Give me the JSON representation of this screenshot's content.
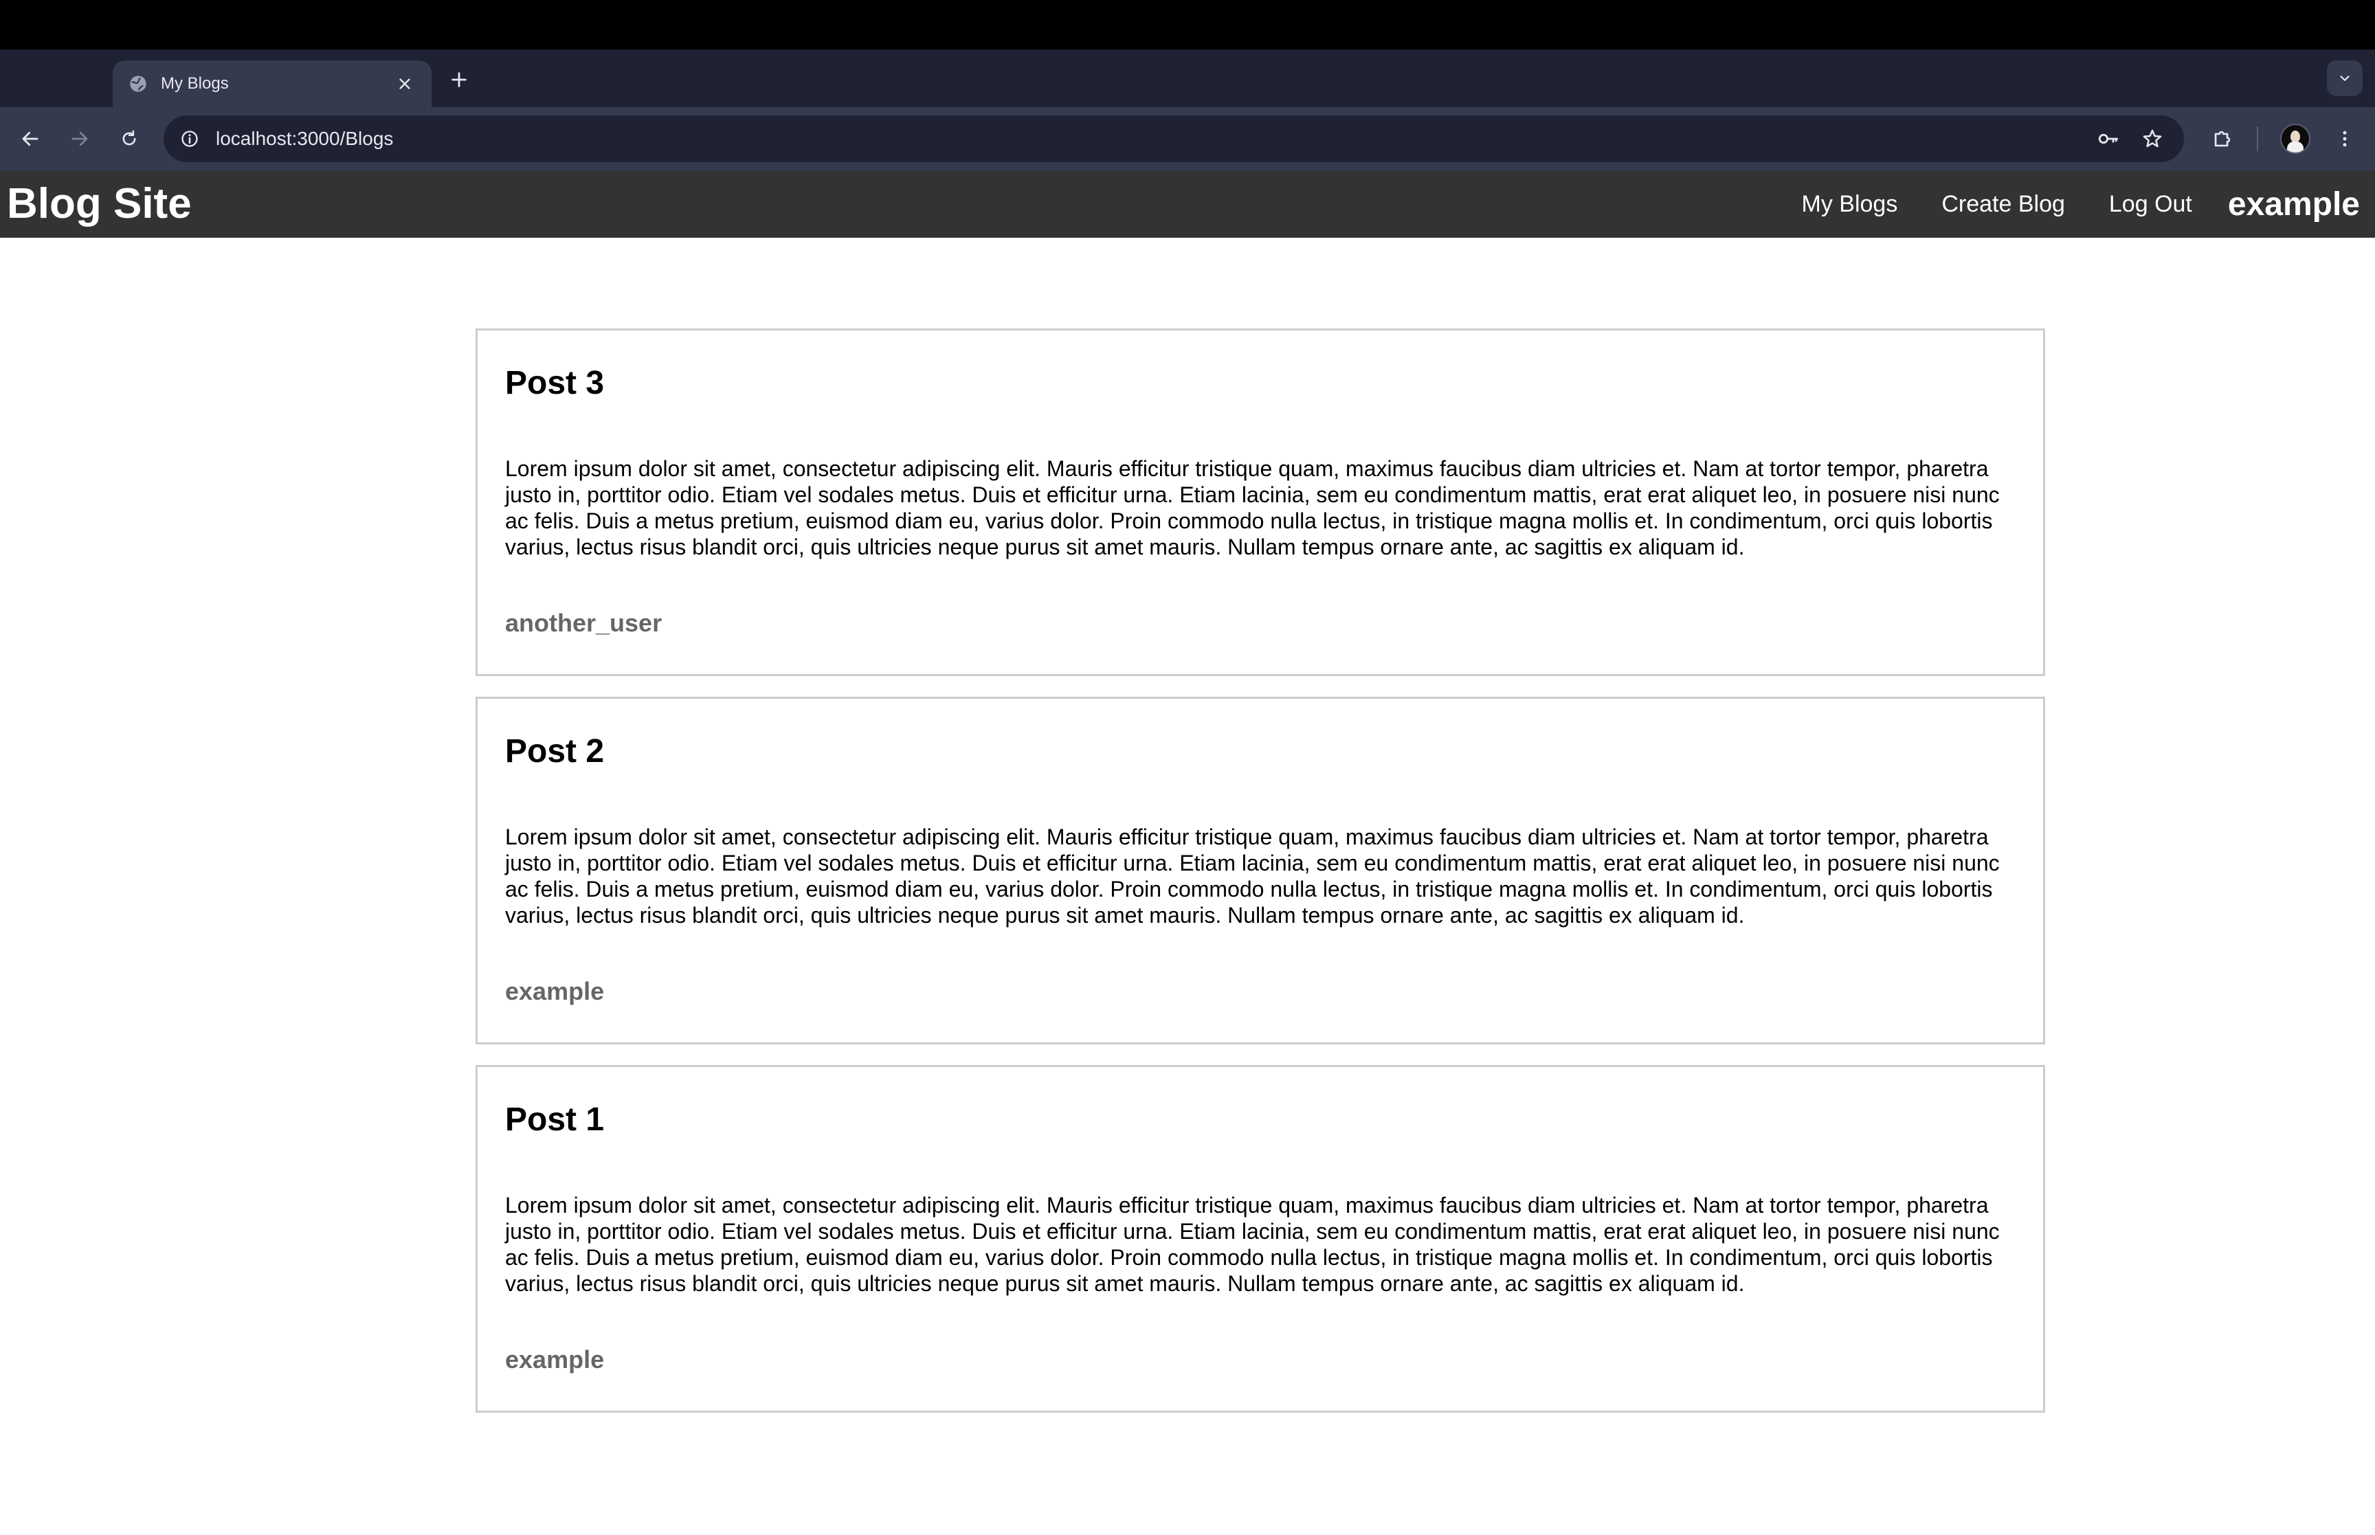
{
  "browser": {
    "tab_title": "My Blogs",
    "url": "localhost:3000/Blogs",
    "icons": [
      "globe-icon",
      "close-icon",
      "plus-icon",
      "chevron-down-icon",
      "back-arrow-icon",
      "forward-arrow-icon",
      "reload-icon",
      "info-icon",
      "key-icon",
      "star-icon",
      "puzzle-icon",
      "avatar",
      "kebab-menu-icon"
    ]
  },
  "site": {
    "brand": "Blog Site",
    "nav": {
      "my_blogs": "My Blogs",
      "create_blog": "Create Blog",
      "log_out": "Log Out",
      "user": "example"
    }
  },
  "posts": [
    {
      "title": "Post 3",
      "body": "Lorem ipsum dolor sit amet, consectetur adipiscing elit. Mauris efficitur tristique quam, maximus faucibus diam ultricies et. Nam at tortor tempor, pharetra justo in, porttitor odio. Etiam vel sodales metus. Duis et efficitur urna. Etiam lacinia, sem eu condimentum mattis, erat erat aliquet leo, in posuere nisi nunc ac felis. Duis a metus pretium, euismod diam eu, varius dolor. Proin commodo nulla lectus, in tristique magna mollis et. In condimentum, orci quis lobortis varius, lectus risus blandit orci, quis ultricies neque purus sit amet mauris. Nullam tempus ornare ante, ac sagittis ex aliquam id.",
      "author": "another_user"
    },
    {
      "title": "Post 2",
      "body": "Lorem ipsum dolor sit amet, consectetur adipiscing elit. Mauris efficitur tristique quam, maximus faucibus diam ultricies et. Nam at tortor tempor, pharetra justo in, porttitor odio. Etiam vel sodales metus. Duis et efficitur urna. Etiam lacinia, sem eu condimentum mattis, erat erat aliquet leo, in posuere nisi nunc ac felis. Duis a metus pretium, euismod diam eu, varius dolor. Proin commodo nulla lectus, in tristique magna mollis et. In condimentum, orci quis lobortis varius, lectus risus blandit orci, quis ultricies neque purus sit amet mauris. Nullam tempus ornare ante, ac sagittis ex aliquam id.",
      "author": "example"
    },
    {
      "title": "Post 1",
      "body": "Lorem ipsum dolor sit amet, consectetur adipiscing elit. Mauris efficitur tristique quam, maximus faucibus diam ultricies et. Nam at tortor tempor, pharetra justo in, porttitor odio. Etiam vel sodales metus. Duis et efficitur urna. Etiam lacinia, sem eu condimentum mattis, erat erat aliquet leo, in posuere nisi nunc ac felis. Duis a metus pretium, euismod diam eu, varius dolor. Proin commodo nulla lectus, in tristique magna mollis et. In condimentum, orci quis lobortis varius, lectus risus blandit orci, quis ultricies neque purus sit amet mauris. Nullam tempus ornare ante, ac sagittis ex aliquam id.",
      "author": "example"
    }
  ],
  "colors": {
    "site_nav_bg": "#333333",
    "author_text": "#666666",
    "card_border": "#cccccc",
    "browser_tabstrip": "#1f2233",
    "browser_toolbar": "#363a4f"
  }
}
